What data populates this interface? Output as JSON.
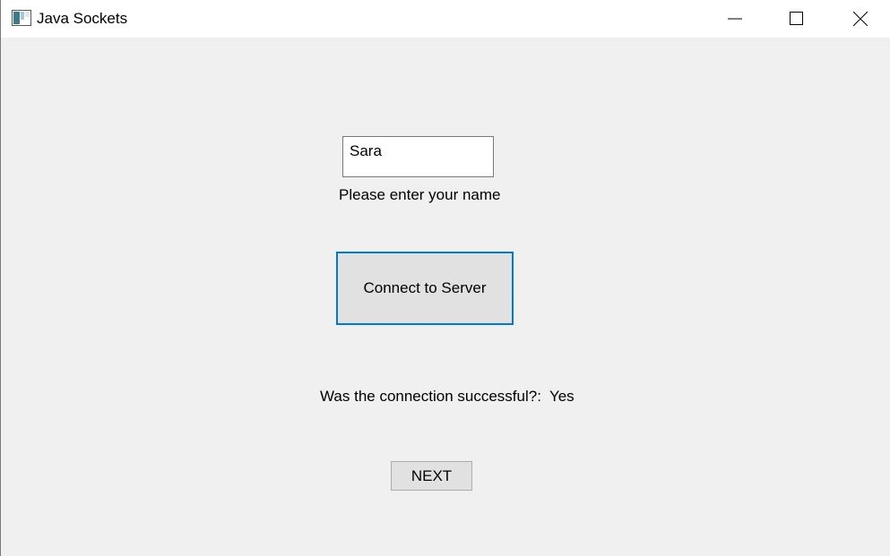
{
  "window": {
    "title": "Java Sockets",
    "controls": {
      "minimize_icon": "minimize-icon",
      "maximize_icon": "maximize-icon",
      "close_icon": "close-icon"
    }
  },
  "form": {
    "name_value": "Sara",
    "name_prompt": "Please enter your name",
    "connect_label": "Connect to Server",
    "status_question": "Was the connection successful?:",
    "status_answer": "Yes",
    "next_label": "NEXT"
  },
  "colors": {
    "background": "#f0f0f0",
    "titlebar": "#ffffff",
    "focus_border": "#0078d7",
    "button_face": "#e1e1e1"
  }
}
